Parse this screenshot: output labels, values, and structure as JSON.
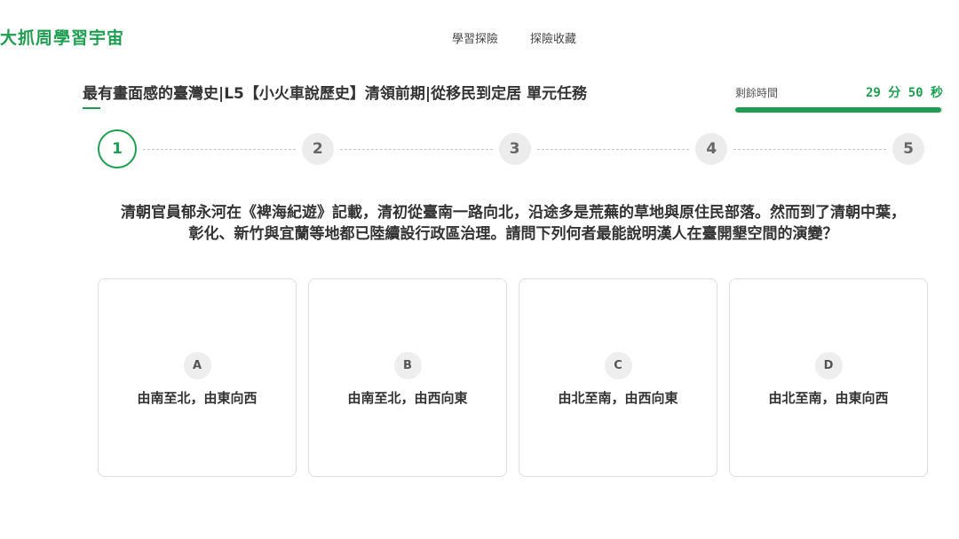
{
  "app": {
    "logo_text": "大抓周學習宇宙",
    "brand_color": "#1f9e52"
  },
  "nav": {
    "items": [
      {
        "label": "學習探險"
      },
      {
        "label": "探險收藏"
      }
    ]
  },
  "lesson": {
    "title": "最有畫面感的臺灣史|L5【小火車說歷史】清領前期|從移民到定居 單元任務"
  },
  "timer": {
    "label": "剩餘時間",
    "value": "29 分 50 秒",
    "progress": 0.99
  },
  "stepper": {
    "current": 1,
    "steps": [
      "1",
      "2",
      "3",
      "4",
      "5"
    ]
  },
  "question": {
    "text": "清朝官員郁永河在《裨海紀遊》記載，清初從臺南一路向北，沿途多是荒蕪的草地與原住民部落。然而到了清朝中葉，彰化、新竹與宜蘭等地都已陸續設行政區治理。請問下列何者最能說明漢人在臺開墾空間的演變？"
  },
  "options": [
    {
      "letter": "A",
      "text": "由南至北，由東向西"
    },
    {
      "letter": "B",
      "text": "由南至北，由西向東"
    },
    {
      "letter": "C",
      "text": "由北至南，由西向東"
    },
    {
      "letter": "D",
      "text": "由北至南，由東向西"
    }
  ]
}
